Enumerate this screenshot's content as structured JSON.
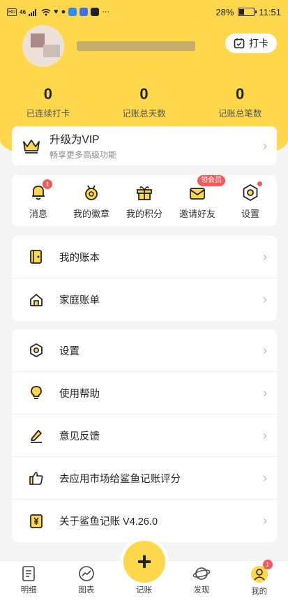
{
  "status_bar": {
    "network_left": "HD",
    "network_speed": "46",
    "battery_percent": "28%",
    "time": "11:51"
  },
  "header": {
    "checkin_label": "打卡"
  },
  "stats": [
    {
      "value": "0",
      "label": "已连续打卡"
    },
    {
      "value": "0",
      "label": "记账总天数"
    },
    {
      "value": "0",
      "label": "记账总笔数"
    }
  ],
  "vip": {
    "title": "升级为VIP",
    "subtitle": "畅享更多高级功能"
  },
  "shortcuts": [
    {
      "label": "消息",
      "icon": "bell-icon",
      "badge": "1"
    },
    {
      "label": "我的徽章",
      "icon": "medal-icon"
    },
    {
      "label": "我的积分",
      "icon": "gift-icon"
    },
    {
      "label": "邀请好友",
      "icon": "envelope-icon",
      "pill": "领会员"
    },
    {
      "label": "设置",
      "icon": "hex-gear-icon"
    }
  ],
  "list_group_1": [
    {
      "label": "我的账本",
      "icon": "ledger-icon"
    },
    {
      "label": "家庭账单",
      "icon": "house-icon"
    }
  ],
  "list_group_2": [
    {
      "label": "设置",
      "icon": "hex-gear-icon"
    },
    {
      "label": "使用帮助",
      "icon": "lightbulb-icon"
    },
    {
      "label": "意见反馈",
      "icon": "pen-icon"
    },
    {
      "label": "去应用市场给鲨鱼记账评分",
      "icon": "thumbs-up-icon"
    },
    {
      "label": "关于鲨鱼记账 V4.26.0",
      "icon": "yen-icon"
    }
  ],
  "tabbar": [
    {
      "label": "明细",
      "icon": "document-icon"
    },
    {
      "label": "图表",
      "icon": "chart-icon"
    },
    {
      "label": "记账",
      "icon": "plus-icon"
    },
    {
      "label": "发现",
      "icon": "planet-icon"
    },
    {
      "label": "我的",
      "icon": "person-icon",
      "badge": "1"
    }
  ],
  "colors": {
    "accent": "#fed84a",
    "badge": "#f15b5b"
  }
}
